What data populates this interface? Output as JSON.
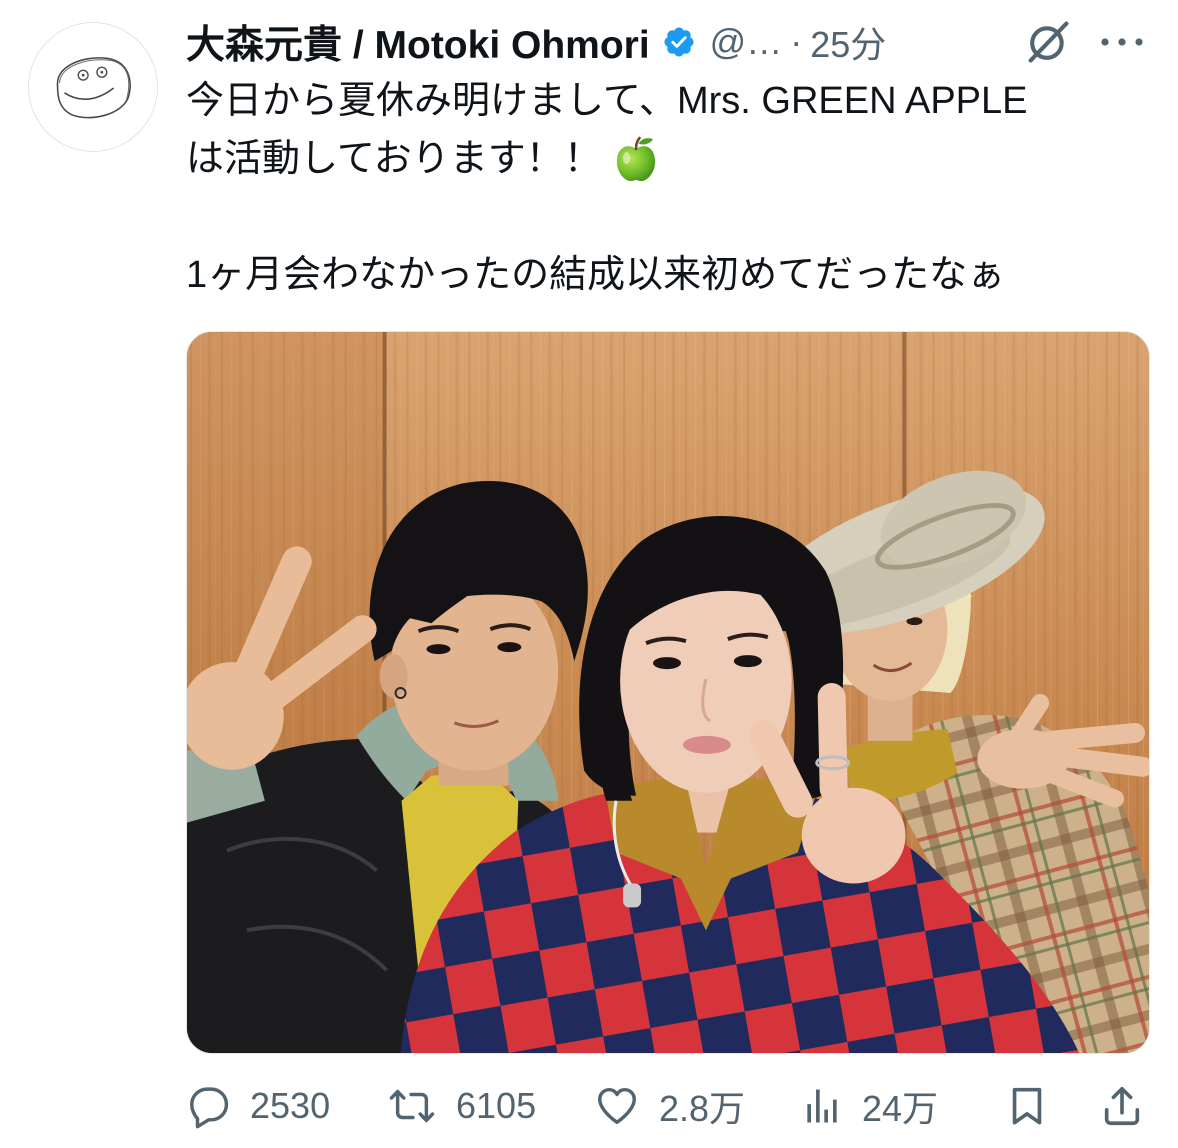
{
  "colors": {
    "text_primary": "#0f1419",
    "text_secondary": "#536471",
    "verified_blue": "#1d9bf0",
    "background": "#ffffff"
  },
  "tweet": {
    "author": {
      "display_name": "大森元貴 / Motoki Ohmori",
      "handle": "@…",
      "verified": true,
      "avatar_icon": "hand-drawn-smiley-avatar"
    },
    "separator": "·",
    "timestamp": "25分",
    "header_icons": [
      "grok-icon",
      "more-options-icon"
    ],
    "text_lines": [
      "今日から夏休み明けまして、Mrs. GREEN APPLE",
      "は活動しております！！",
      "1ヶ月会わなかったの結成以来初めてだったなぁ"
    ],
    "text_emoji_icon": "green-apple-emoji",
    "actions": [
      {
        "icon": "reply-icon",
        "count": "2530"
      },
      {
        "icon": "repost-icon",
        "count": "6105"
      },
      {
        "icon": "like-icon",
        "count": "2.8万"
      },
      {
        "icon": "views-icon",
        "count": "24万"
      },
      {
        "icon": "bookmark-icon"
      },
      {
        "icon": "share-icon"
      }
    ]
  }
}
